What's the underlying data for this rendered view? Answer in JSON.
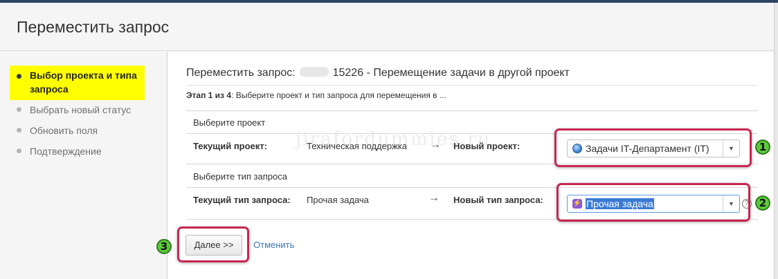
{
  "dialog": {
    "title": "Переместить запрос"
  },
  "sidebar": {
    "steps": [
      {
        "label": "Выбор проекта и типа запроса",
        "active": true
      },
      {
        "label": "Выбрать новый статус",
        "active": false
      },
      {
        "label": "Обновить поля",
        "active": false
      },
      {
        "label": "Подтверждение",
        "active": false
      }
    ]
  },
  "main": {
    "heading_prefix": "Переместить запрос:",
    "heading_suffix": "15226 - Перемещение задачи в другой проект",
    "stage_bold": "Этап 1 из 4",
    "stage_text": ": Выберите проект и тип запроса для перемещения в ...",
    "project": {
      "section_title": "Выберите проект",
      "current_label": "Текущий проект:",
      "current_value": "Техническая поддержка",
      "arrow": "→",
      "new_label": "Новый проект:",
      "new_value": "Задачи IT-Департамент (IT)"
    },
    "issue_type": {
      "section_title": "Выберите тип запроса",
      "current_label": "Текущий тип запроса:",
      "current_value": "Прочая задача",
      "arrow": "→",
      "new_label": "Новый тип запроса:",
      "new_value": "Прочая задача"
    }
  },
  "actions": {
    "next_label": "Далее >>",
    "cancel_label": "Отменить"
  },
  "annotations": {
    "badge1": "1",
    "badge2": "2",
    "badge3": "3",
    "watermark": "jirafordummies.ru"
  },
  "colors": {
    "highlight": "#ffff00",
    "callout": "#c8254f",
    "badge": "#5cc73b",
    "link": "#3b73af",
    "selection": "#3b7bd6"
  }
}
